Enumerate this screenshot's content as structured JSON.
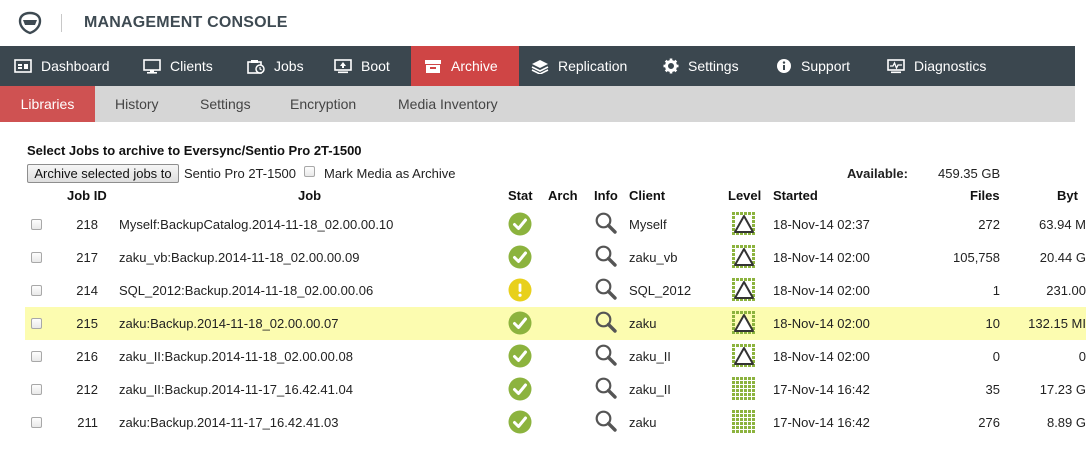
{
  "app": {
    "title": "MANAGEMENT CONSOLE"
  },
  "main_nav": [
    {
      "label": "Dashboard",
      "icon": "dashboard-icon",
      "active": false
    },
    {
      "label": "Clients",
      "icon": "monitor-icon",
      "active": false
    },
    {
      "label": "Jobs",
      "icon": "jobs-icon",
      "active": false
    },
    {
      "label": "Boot",
      "icon": "boot-icon",
      "active": false
    },
    {
      "label": "Archive",
      "icon": "archive-icon",
      "active": true
    },
    {
      "label": "Replication",
      "icon": "layers-icon",
      "active": false
    },
    {
      "label": "Settings",
      "icon": "gear-icon",
      "active": false
    },
    {
      "label": "Support",
      "icon": "info-icon",
      "active": false
    },
    {
      "label": "Diagnostics",
      "icon": "diagnostics-icon",
      "active": false
    }
  ],
  "sub_nav": [
    {
      "label": "Libraries",
      "active": true
    },
    {
      "label": "History",
      "active": false
    },
    {
      "label": "Settings",
      "active": false
    },
    {
      "label": "Encryption",
      "active": false
    },
    {
      "label": "Media Inventory",
      "active": false
    }
  ],
  "content": {
    "heading": "Select Jobs to archive to Eversync/Sentio Pro 2T-1500",
    "archive_button": "Archive selected jobs to",
    "target": "Sentio Pro 2T-1500",
    "mark_media_label": "Mark Media as Archive",
    "available_label": "Available:",
    "available_value": "459.35 GB"
  },
  "table": {
    "headers": {
      "job_id": "Job ID",
      "job": "Job",
      "stat": "Stat",
      "arch": "Arch",
      "info": "Info",
      "client": "Client",
      "level": "Level",
      "started": "Started",
      "files": "Files",
      "bytes": "Byt"
    },
    "rows": [
      {
        "id": "218",
        "job": "Myself:BackupCatalog.2014-11-18_02.00.00.10",
        "stat": "ok",
        "client": "Myself",
        "level": "differential",
        "started": "18-Nov-14 02:37",
        "files": "272",
        "bytes": "63.94 M",
        "highlight": false
      },
      {
        "id": "217",
        "job": "zaku_vb:Backup.2014-11-18_02.00.00.09",
        "stat": "ok",
        "client": "zaku_vb",
        "level": "differential",
        "started": "18-Nov-14 02:00",
        "files": "105,758",
        "bytes": "20.44 G",
        "highlight": false
      },
      {
        "id": "214",
        "job": "SQL_2012:Backup.2014-11-18_02.00.00.06",
        "stat": "warning",
        "client": "SQL_2012",
        "level": "differential",
        "started": "18-Nov-14 02:00",
        "files": "1",
        "bytes": "231.00",
        "highlight": false
      },
      {
        "id": "215",
        "job": "zaku:Backup.2014-11-18_02.00.00.07",
        "stat": "ok",
        "client": "zaku",
        "level": "differential",
        "started": "18-Nov-14 02:00",
        "files": "10",
        "bytes": "132.15 MI",
        "highlight": true
      },
      {
        "id": "216",
        "job": "zaku_II:Backup.2014-11-18_02.00.00.08",
        "stat": "ok",
        "client": "zaku_II",
        "level": "differential",
        "started": "18-Nov-14 02:00",
        "files": "0",
        "bytes": "0",
        "highlight": false
      },
      {
        "id": "212",
        "job": "zaku_II:Backup.2014-11-17_16.42.41.04",
        "stat": "ok",
        "client": "zaku_II",
        "level": "full",
        "started": "17-Nov-14 16:42",
        "files": "35",
        "bytes": "17.23 G",
        "highlight": false
      },
      {
        "id": "211",
        "job": "zaku:Backup.2014-11-17_16.42.41.03",
        "stat": "ok",
        "client": "zaku",
        "level": "full",
        "started": "17-Nov-14 16:42",
        "files": "276",
        "bytes": "8.89 G",
        "highlight": false
      }
    ]
  },
  "colors": {
    "nav_bg": "#3b474f",
    "active": "#cf4545",
    "subnav_bg": "#d6d6d6",
    "ok": "#8cb33e",
    "warning": "#e8d01c",
    "highlight": "#fcfcb0"
  }
}
